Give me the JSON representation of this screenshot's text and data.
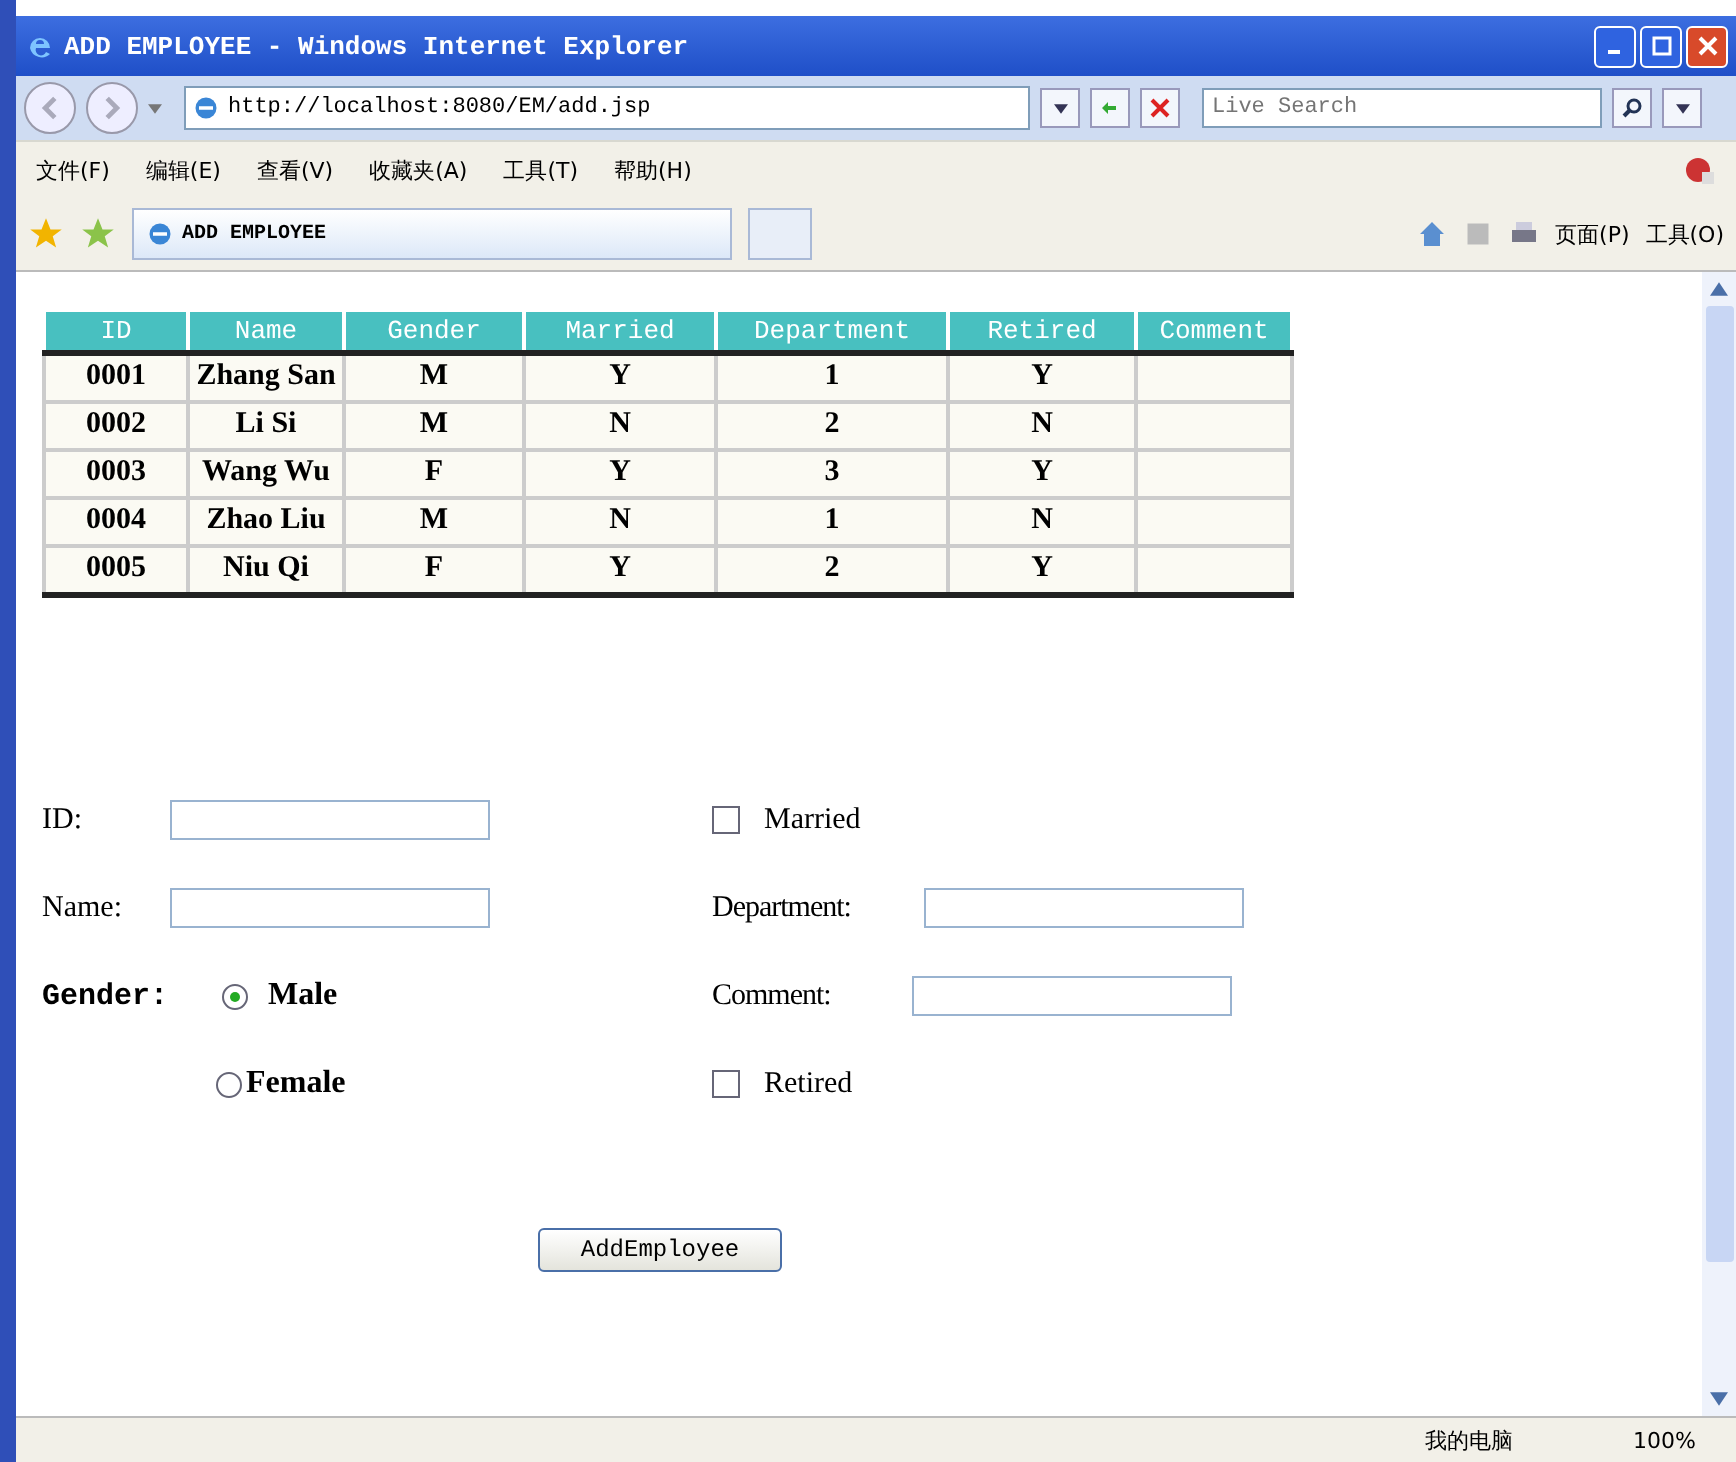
{
  "window": {
    "title": "ADD EMPLOYEE - Windows Internet Explorer"
  },
  "address_bar": {
    "url": "http://localhost:8080/EM/add.jsp"
  },
  "search": {
    "placeholder": "Live Search"
  },
  "menu": [
    "文件(F)",
    "编辑(E)",
    "查看(V)",
    "收藏夹(A)",
    "工具(T)",
    "帮助(H)"
  ],
  "tab": {
    "title": "ADD EMPLOYEE"
  },
  "command_bar": [
    "页面(P)",
    "工具(O)"
  ],
  "table": {
    "columns": [
      "ID",
      "Name",
      "Gender",
      "Married",
      "Department",
      "Retired",
      "Comment"
    ],
    "rows": [
      [
        "0001",
        "Zhang San",
        "M",
        "Y",
        "1",
        "Y"
      ],
      [
        "0002",
        "Li Si",
        "M",
        "N",
        "2",
        "N"
      ],
      [
        "0003",
        "Wang Wu",
        "F",
        "Y",
        "3",
        "Y"
      ],
      [
        "0004",
        "Zhao Liu",
        "M",
        "N",
        "1",
        "N"
      ],
      [
        "0005",
        "Niu Qi",
        "F",
        "Y",
        "2",
        "Y"
      ]
    ]
  },
  "form": {
    "id_label": "ID:",
    "name_label": "Name:",
    "gender_label": "Gender:",
    "genders": [
      {
        "label": "Male",
        "selected": true
      },
      {
        "label": "Female",
        "selected": false
      }
    ],
    "married": {
      "label": "Married",
      "checked": false
    },
    "department_label": "Department:",
    "comment_label": "Comment:",
    "retired": {
      "label": "Retired",
      "checked": false
    },
    "submit": "AddEmployee"
  },
  "status_bar": {
    "zone": "我的电脑",
    "zoom": "100%"
  }
}
